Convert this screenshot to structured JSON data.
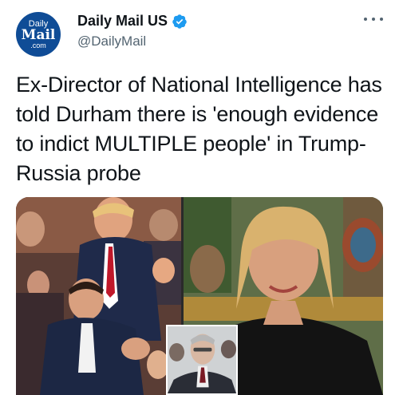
{
  "account": {
    "display_name": "Daily Mail US",
    "handle": "@DailyMail",
    "avatar_text": {
      "line1": "Daily",
      "line2": "Mail",
      "line3": ".com"
    }
  },
  "tweet": {
    "text": "Ex-Director of National Intelligence has told Durham there is 'enough evidence to indict MULTIPLE people' in Trump-Russia probe"
  },
  "icons": {
    "verified": "verified-badge-icon",
    "more": "more-horizontal-icon"
  },
  "colors": {
    "verified_blue": "#1d9bf0",
    "brand_blue": "#0f4c96",
    "secondary_text": "#536471"
  }
}
